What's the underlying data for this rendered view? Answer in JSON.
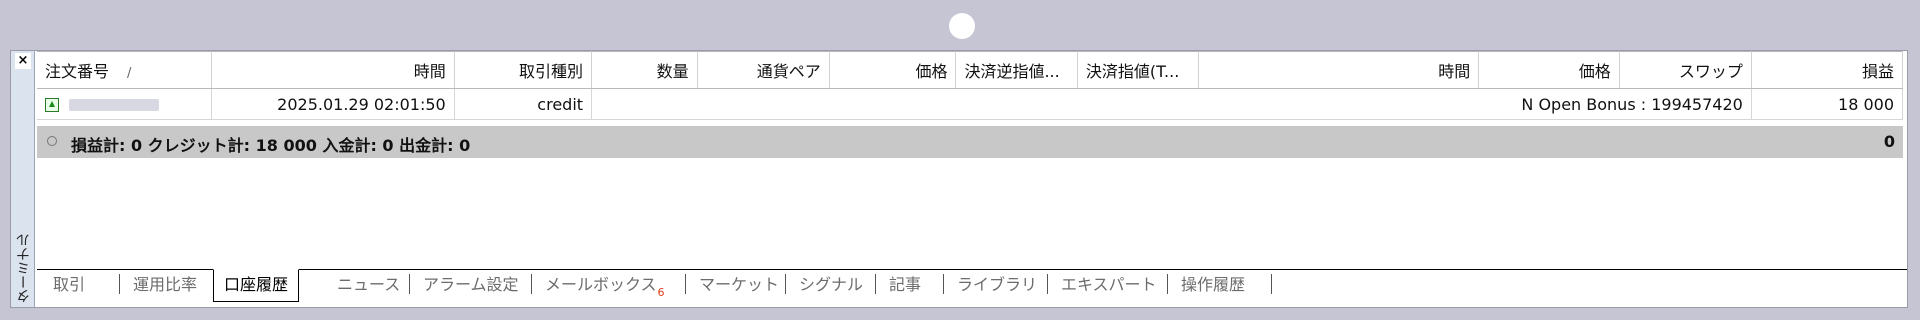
{
  "window": {
    "close_glyph": "×",
    "side_title": "ターミナル"
  },
  "columns": [
    "注文番号",
    "時間",
    "取引種別",
    "数量",
    "通貨ペア",
    "価格",
    "決済逆指値...",
    "決済指値(T...",
    "時間",
    "価格",
    "スワップ",
    "損益"
  ],
  "sort_indicator": "/",
  "row": {
    "icon": "buy-arrow-icon",
    "time": "2025.01.29 02:01:50",
    "type": "credit",
    "comment": "N Open Bonus : 199457420",
    "profit": "18 000"
  },
  "summary": {
    "text": "損益計: 0  クレジット計: 18 000  入金計: 0  出金計: 0",
    "total": "0"
  },
  "tabs": [
    {
      "label": "取引"
    },
    {
      "label": "運用比率"
    },
    {
      "label": "口座履歴",
      "active": true
    },
    {
      "label": "ニュース"
    },
    {
      "label": "アラーム設定"
    },
    {
      "label": "メールボックス",
      "badge": "6"
    },
    {
      "label": "マーケット"
    },
    {
      "label": "シグナル"
    },
    {
      "label": "記事"
    },
    {
      "label": "ライブラリ"
    },
    {
      "label": "エキスパート"
    },
    {
      "label": "操作履歴"
    }
  ],
  "colors": {
    "summary_bg": "#c8c8c8",
    "badge": "#e03c1c",
    "side_panel": "#dbe3ee"
  }
}
